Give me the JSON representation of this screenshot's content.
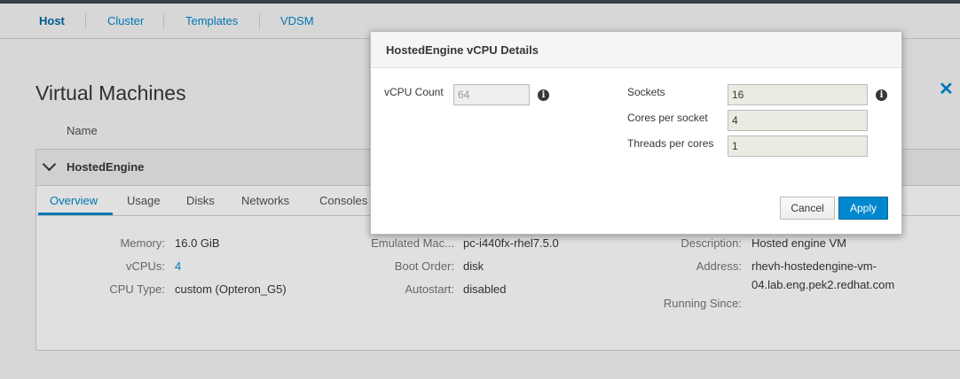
{
  "nav": {
    "tabs": [
      "Host",
      "Cluster",
      "Templates",
      "VDSM"
    ]
  },
  "page": {
    "title": "Virtual Machines",
    "column_header": "Name"
  },
  "vm": {
    "name": "HostedEngine",
    "subtabs": [
      "Overview",
      "Usage",
      "Disks",
      "Networks",
      "Consoles"
    ],
    "details": {
      "memory_label": "Memory:",
      "memory_value": "16.0 GiB",
      "vcpus_label": "vCPUs:",
      "vcpus_value": "4",
      "cpu_type_label": "CPU Type:",
      "cpu_type_value": "custom (Opteron_G5)",
      "emulated_machine_label": "Emulated Mac...",
      "emulated_machine_value": "pc-i440fx-rhel7.5.0",
      "boot_order_label": "Boot Order:",
      "boot_order_value": "disk",
      "autostart_label": "Autostart:",
      "autostart_value": "disabled",
      "description_label": "Description:",
      "description_value": "Hosted engine VM",
      "address_label": "Address:",
      "address_value_line1": "rhevh-hostedengine-vm-",
      "address_value_line2": "04.lab.eng.pek2.redhat.com",
      "running_since_label": "Running Since:"
    }
  },
  "modal": {
    "title": "HostedEngine vCPU Details",
    "vcpu_count_label": "vCPU Count",
    "vcpu_count_value": "64",
    "sockets_label": "Sockets",
    "sockets_value": "16",
    "cores_label": "Cores per socket",
    "cores_value": "4",
    "threads_label": "Threads per cores",
    "threads_value": "1",
    "cancel_label": "Cancel",
    "apply_label": "Apply"
  },
  "icons": {
    "info": "info-icon",
    "close": "close-icon",
    "chevron": "chevron-down-icon"
  },
  "colors": {
    "accent": "#0088ce",
    "topbar": "#393f44"
  }
}
